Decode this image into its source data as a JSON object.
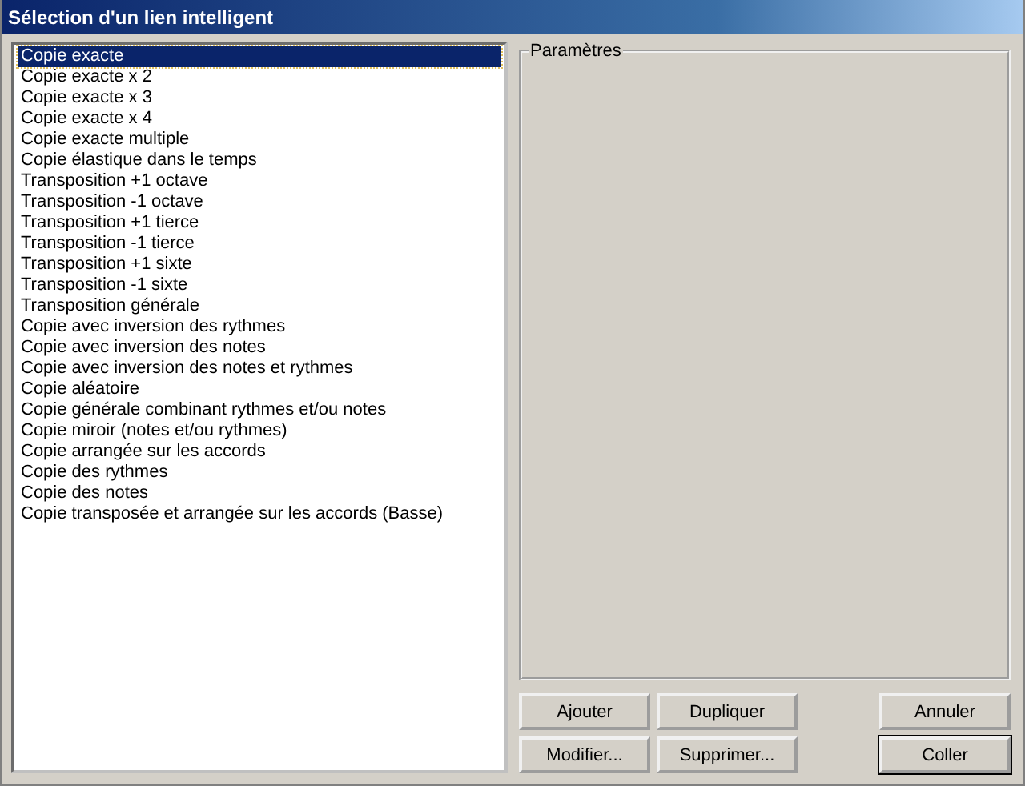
{
  "window": {
    "title": "Sélection d'un lien intelligent"
  },
  "list": [
    {
      "label": "Copie exacte",
      "selected": true
    },
    {
      "label": "Copie exacte x 2",
      "selected": false
    },
    {
      "label": "Copie exacte x 3",
      "selected": false
    },
    {
      "label": "Copie exacte x 4",
      "selected": false
    },
    {
      "label": "Copie exacte multiple",
      "selected": false
    },
    {
      "label": "Copie élastique dans le temps",
      "selected": false
    },
    {
      "label": "Transposition +1 octave",
      "selected": false
    },
    {
      "label": "Transposition -1 octave",
      "selected": false
    },
    {
      "label": "Transposition +1 tierce",
      "selected": false
    },
    {
      "label": "Transposition -1 tierce",
      "selected": false
    },
    {
      "label": "Transposition +1 sixte",
      "selected": false
    },
    {
      "label": "Transposition -1 sixte",
      "selected": false
    },
    {
      "label": "Transposition générale",
      "selected": false
    },
    {
      "label": "Copie avec inversion des rythmes",
      "selected": false
    },
    {
      "label": "Copie avec inversion des notes",
      "selected": false
    },
    {
      "label": "Copie avec inversion des notes et rythmes",
      "selected": false
    },
    {
      "label": "Copie aléatoire",
      "selected": false
    },
    {
      "label": "Copie générale combinant rythmes et/ou notes",
      "selected": false
    },
    {
      "label": "Copie miroir (notes et/ou rythmes)",
      "selected": false
    },
    {
      "label": "Copie arrangée sur les accords",
      "selected": false
    },
    {
      "label": "Copie des rythmes",
      "selected": false
    },
    {
      "label": "Copie des notes",
      "selected": false
    },
    {
      "label": "Copie transposée et arrangée sur les accords (Basse)",
      "selected": false
    }
  ],
  "parameters": {
    "legend": "Paramètres"
  },
  "buttons_left": [
    {
      "label": "Ajouter",
      "default": false
    },
    {
      "label": "Dupliquer",
      "default": false
    },
    {
      "label": "Modifier...",
      "default": false
    },
    {
      "label": "Supprimer...",
      "default": false
    }
  ],
  "buttons_right": [
    {
      "label": "Annuler",
      "default": false
    },
    {
      "label": "Coller",
      "default": true
    }
  ]
}
